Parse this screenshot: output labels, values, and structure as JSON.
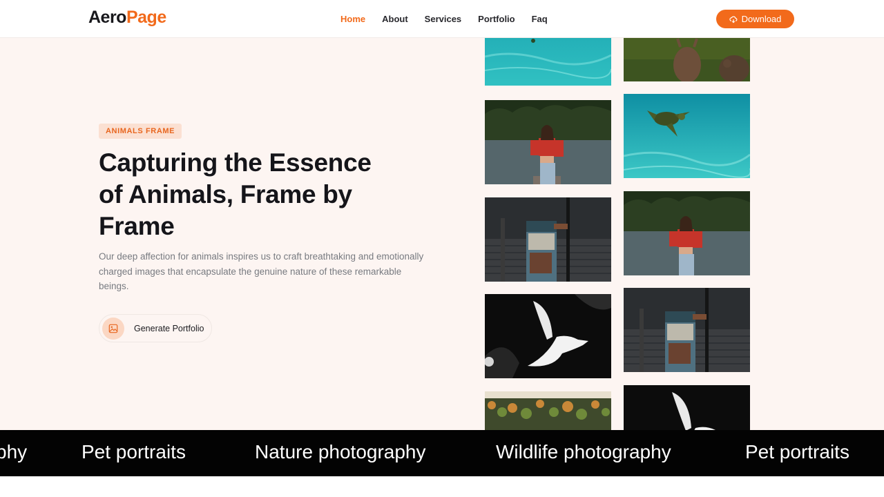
{
  "header": {
    "logo": {
      "part1": "Aero",
      "part2": "Page"
    },
    "nav": [
      "Home",
      "About",
      "Services",
      "Portfolio",
      "Faq"
    ],
    "download_label": "Download"
  },
  "hero": {
    "badge": "ANIMALS FRAME",
    "title": "Capturing the Essence of Animals, Frame by Frame",
    "description": "Our deep affection for animals inspires us to craft breathtaking and emotionally charged images that encapsulate the genuine nature of these remarkable beings.",
    "cta_label": "Generate Portfolio"
  },
  "gallery": {
    "left_column": [
      "sea-water",
      "woman-lake",
      "old-machine",
      "white-dove",
      "autumn-garden"
    ],
    "right_column": [
      "deer-grass",
      "sea-turtle",
      "woman-lake",
      "old-machine",
      "white-dove"
    ]
  },
  "marquee": {
    "items": [
      "phy",
      "Pet portraits",
      "Nature photography",
      "Wildlife photography",
      "Pet portraits"
    ]
  },
  "colors": {
    "accent": "#f26a1b",
    "hero_bg": "#fdf5f2",
    "marquee_bg": "#030303"
  }
}
